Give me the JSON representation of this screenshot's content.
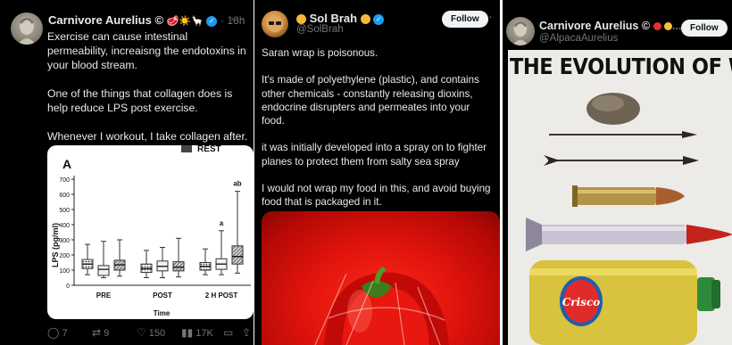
{
  "panel1": {
    "author_name": "Carnivore Aurelius ©",
    "emojis": [
      "🥩",
      "☀️",
      "🦙"
    ],
    "time": "· 16h",
    "text": "Exercise can cause intestinal permeability, increaisng the endotoxins in your blood stream.\n\nOne of the things that collagen does is help reduce LPS post exercise.\n\nWhenever I workout, I take collagen after.",
    "chart": {
      "panel_label": "A",
      "header_fragment": "REST",
      "chart_data": {
        "type": "box",
        "ylabel": "LPS (pg/ml)",
        "xlabel": "Time",
        "ylim": [
          0,
          700
        ],
        "yticks": [
          "700",
          "600",
          "500",
          "400",
          "300",
          "200",
          "100",
          "0"
        ],
        "categories": [
          "PRE",
          "POST",
          "2 H POST"
        ],
        "boxes": [
          {
            "group": "PRE",
            "pattern": "dotted",
            "q1": 110,
            "median": 140,
            "q3": 170,
            "min": 70,
            "max": 270
          },
          {
            "group": "PRE",
            "pattern": "plain",
            "q1": 65,
            "median": 105,
            "q3": 130,
            "min": 50,
            "max": 290
          },
          {
            "group": "PRE",
            "pattern": "hatched",
            "q1": 100,
            "median": 135,
            "q3": 165,
            "min": 60,
            "max": 300
          },
          {
            "group": "POST",
            "pattern": "dotted",
            "q1": 85,
            "median": 110,
            "q3": 140,
            "min": 50,
            "max": 230
          },
          {
            "group": "POST",
            "pattern": "plain",
            "q1": 95,
            "median": 125,
            "q3": 160,
            "min": 50,
            "max": 250
          },
          {
            "group": "POST",
            "pattern": "hatched",
            "q1": 95,
            "median": 120,
            "q3": 155,
            "min": 55,
            "max": 310
          },
          {
            "group": "2 H POST",
            "pattern": "dotted",
            "q1": 100,
            "median": 125,
            "q3": 150,
            "min": 70,
            "max": 240
          },
          {
            "group": "2 H POST",
            "pattern": "plain",
            "q1": 105,
            "median": 140,
            "q3": 175,
            "min": 70,
            "max": 360
          },
          {
            "group": "2 H POST",
            "pattern": "hatched",
            "q1": 140,
            "median": 190,
            "q3": 260,
            "min": 80,
            "max": 620
          }
        ],
        "annotations": [
          "a",
          "ab"
        ]
      }
    },
    "actions": {
      "replies": "7",
      "retweets": "9",
      "likes": "150",
      "views": "17K"
    }
  },
  "panel2": {
    "author_name": "Sol Brah",
    "handle": "@SolBrah",
    "follow_label": "Follow",
    "text": "Saran wrap is poisonous.\n\nIt's made of polyethylene (plastic), and contains other chemicals - constantly releasing dioxins, endocrine disrupters and permeates into your food.\n\nit was initially developed into a spray on to fighter planes to protect them from salty sea spray\n\nI would not wrap my food in this, and avoid buying food that is packaged in it."
  },
  "panel3": {
    "author_name": "Carnivore Aurelius ©",
    "handle": "@AlpacaAurelius",
    "follow_label": "Follow",
    "image_title": "THE EVOLUTION OF WAR",
    "bottle_label": "Crisco"
  },
  "colors": {
    "background": "#000000",
    "text": "#e7e9ea",
    "muted": "#71767b",
    "verified": "#1d9bf0",
    "follow_bg": "#eff3f4"
  }
}
